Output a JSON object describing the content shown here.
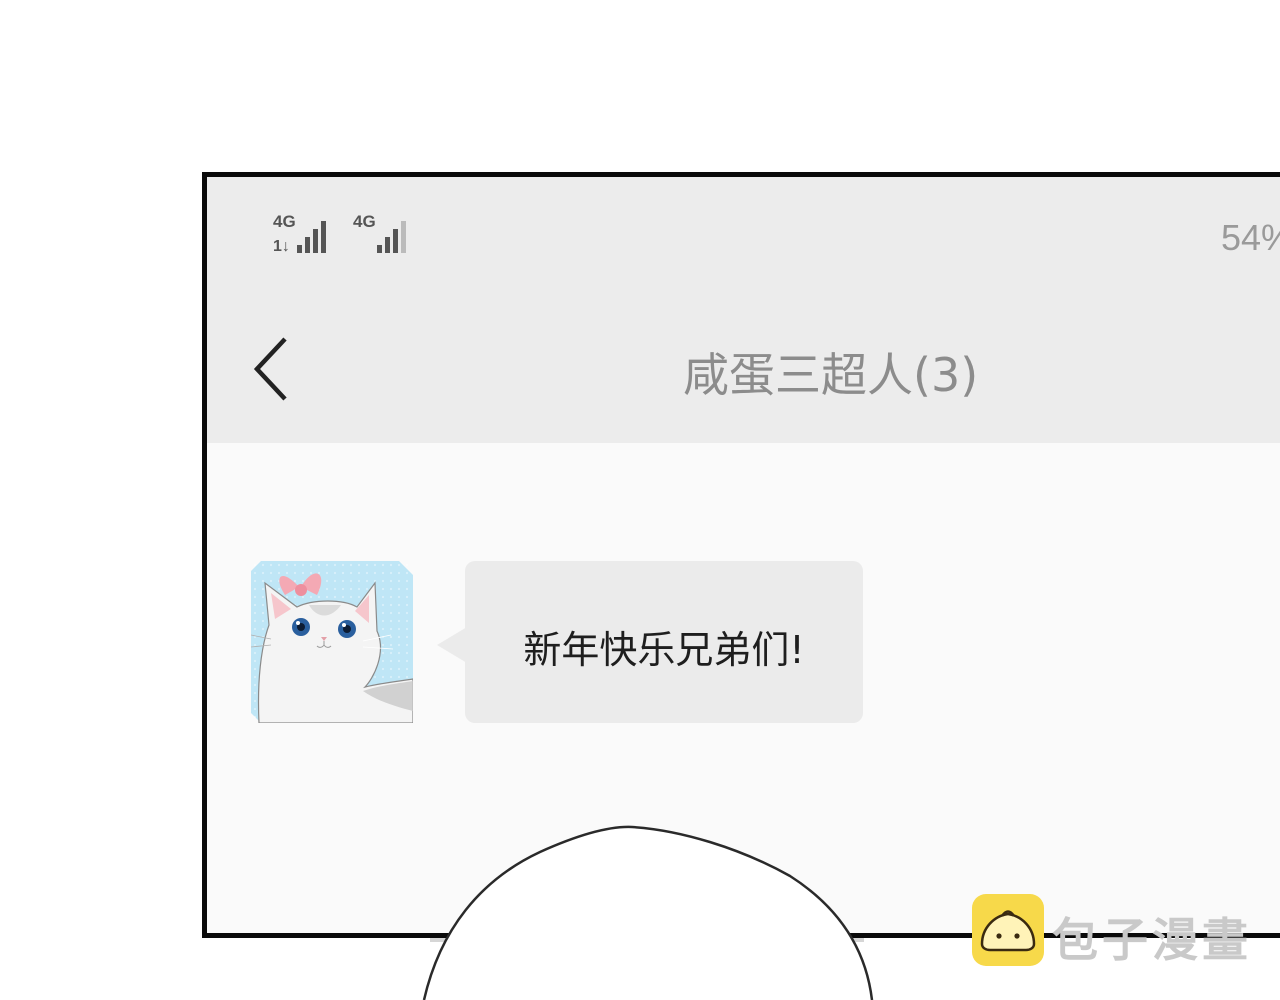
{
  "status_bar": {
    "signal_1": {
      "network": "4G",
      "sub": "1↓",
      "strength_bars": 4,
      "max_bars": 4
    },
    "signal_2": {
      "network": "4G",
      "strength_bars": 3,
      "max_bars": 4
    },
    "battery_text": "54%"
  },
  "header": {
    "back_icon": "chevron-left-icon",
    "title": "咸蛋三超人(3)"
  },
  "chat": {
    "messages": [
      {
        "avatar_icon": "cat-with-pink-bow-avatar",
        "text": "新年快乐兄弟们!"
      }
    ]
  },
  "watermark": {
    "text": "包子漫畫",
    "logo_icon": "steamed-bun-icon",
    "logo_color": "#f7d94a"
  },
  "colors": {
    "panel_frame": "#0a0a0a",
    "status_bg": "#ececec",
    "chat_bg": "#fafafa",
    "bubble_bg": "#ebebeb",
    "title_text": "#8c8c8c"
  }
}
